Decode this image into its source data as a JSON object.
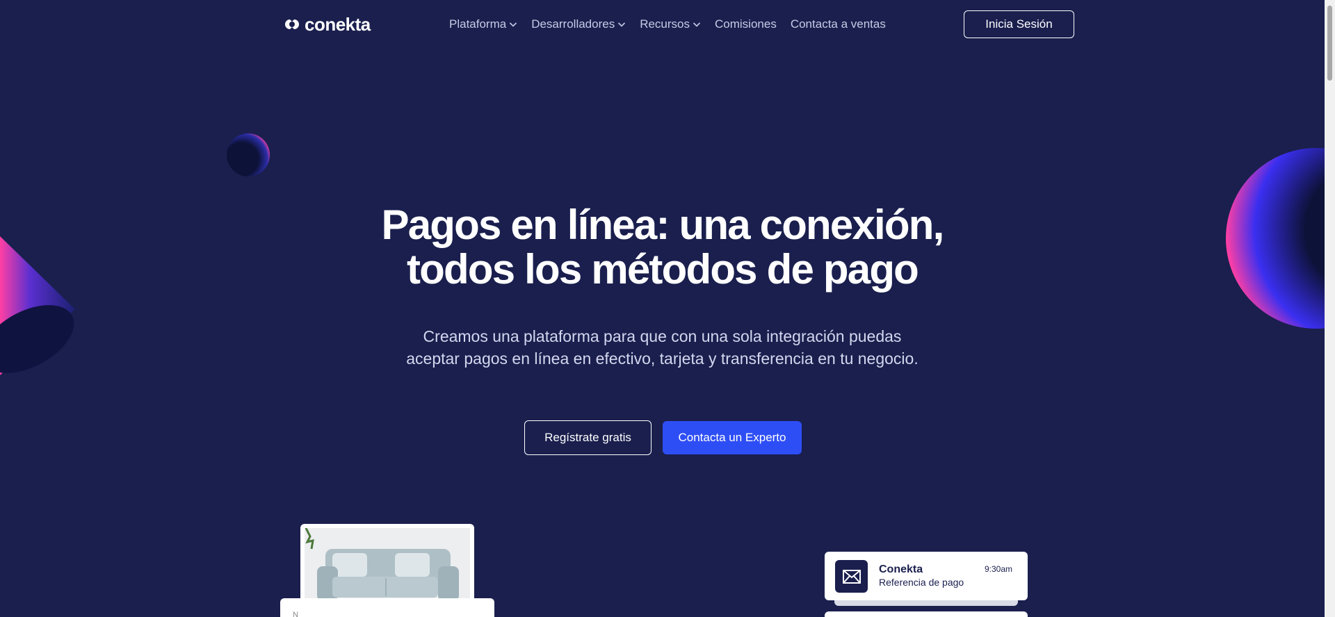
{
  "brand": {
    "name": "conekta"
  },
  "nav": {
    "items": [
      {
        "label": "Plataforma",
        "has_dropdown": true
      },
      {
        "label": "Desarrolladores",
        "has_dropdown": true
      },
      {
        "label": "Recursos",
        "has_dropdown": true
      },
      {
        "label": "Comisiones",
        "has_dropdown": false
      },
      {
        "label": "Contacta a ventas",
        "has_dropdown": false
      }
    ],
    "login_label": "Inicia Sesión"
  },
  "hero": {
    "title_line1": "Pagos en línea: una conexión,",
    "title_line2": "todos los métodos de pago",
    "subtitle_line1": "Creamos una plataforma para que con una sola integración puedas",
    "subtitle_line2": "aceptar pagos en línea en efectivo, tarjeta y transferencia en tu negocio.",
    "cta_secondary": "Regístrate gratis",
    "cta_primary": "Contacta un Experto"
  },
  "notification": {
    "title": "Conekta",
    "text": "Referencia de pago",
    "time": "9:30am",
    "icon": "mail-icon"
  },
  "form_preview": {
    "label": "N"
  },
  "colors": {
    "background": "#1a1f4e",
    "primary": "#2e4ef5",
    "accent_pink": "#ff3fa4",
    "text_muted": "#c7cbe6"
  }
}
